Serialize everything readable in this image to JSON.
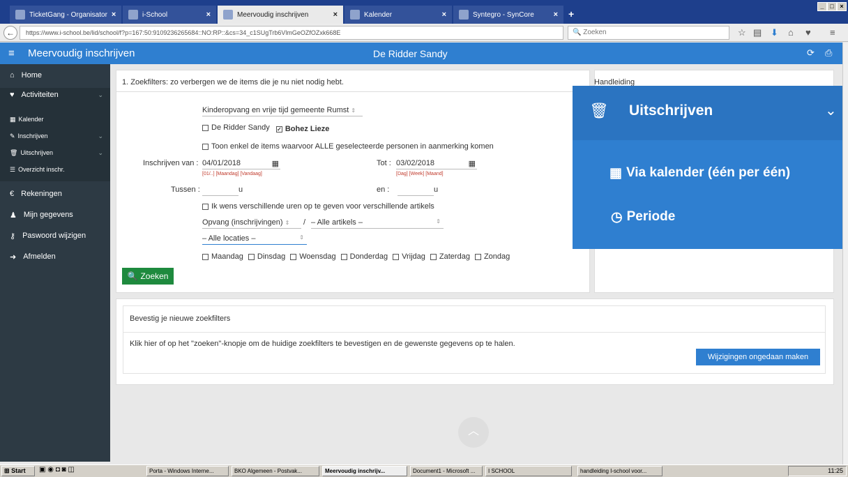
{
  "browser": {
    "tabs": [
      {
        "label": "TicketGang - Organisator"
      },
      {
        "label": "i-School"
      },
      {
        "label": "Meervoudig inschrijven"
      },
      {
        "label": "Kalender"
      },
      {
        "label": "Syntegro - SynCore"
      }
    ],
    "url": "https://www.i-school.be/lid/school/f?p=167:50:9109236265684::NO:RP::&cs=34_c1SUgTrb6VlmGeOZfOZxk668E",
    "search_placeholder": "Zoeken"
  },
  "app": {
    "title": "Meervoudig inschrijven",
    "user": "De Ridder Sandy"
  },
  "sidebar": {
    "home": "Home",
    "activiteiten": "Activiteiten",
    "kalender": "Kalender",
    "inschrijven": "Inschrijven",
    "uitschrijven": "Uitschrijven",
    "overzicht": "Overzicht inschr.",
    "rekeningen": "Rekeningen",
    "mijn_gegevens": "Mijn gegevens",
    "paswoord": "Paswoord wijzigen",
    "afmelden": "Afmelden"
  },
  "filters": {
    "heading": "1. Zoekfilters: zo verbergen we de items die je nu niet nodig hebt.",
    "group_select": "Kinderopvang en vrije tijd gemeente Rumst",
    "person1": "De Ridder Sandy",
    "person2": "Bohez Lieze",
    "only_all_label": "Toon enkel de items waarvoor ALLE geselecteerde personen in aanmerking komen",
    "inschrijven_van_label": "Inschrijven van :",
    "date_from": "04/01/2018",
    "from_shortcuts": "[01/..] [Maandag] [Vandaag]",
    "tot_label": "Tot :",
    "date_to": "03/02/2018",
    "to_shortcuts": "[Dag] [Week] [Maand]",
    "tussen_label": "Tussen :",
    "en_label": "en :",
    "hour_unit": "u",
    "different_hours_label": "Ik wens verschillende uren op te geven voor verschillende artikels",
    "type_select": "Opvang (inschrijvingen)",
    "slash": "/",
    "articles_select": "– Alle artikels –",
    "locations_select": "– Alle locaties –",
    "days": [
      "Maandag",
      "Dinsdag",
      "Woensdag",
      "Donderdag",
      "Vrijdag",
      "Zaterdag",
      "Zondag"
    ],
    "search_button": "Zoeken"
  },
  "handleiding": {
    "title": "Handleiding"
  },
  "confirm": {
    "title": "Bevestig je nieuwe zoekfilters",
    "text": "Klik hier of op het \"zoeken\"-knopje om de huidige zoekfilters te bevestigen en de gewenste gegevens op te halen.",
    "undo_button": "Wijzigingen ongedaan maken"
  },
  "overlay": {
    "title": "Uitschrijven",
    "item1": "Via kalender (één per één)",
    "item2": "Periode"
  },
  "taskbar": {
    "start": "Start",
    "items": [
      "Porta - Windows Interne...",
      "BKO Algemeen - Postvak...",
      "Meervoudig inschrijv...",
      "Document1 - Microsoft ...",
      "I SCHOOL",
      "handleiding I-school voor..."
    ],
    "clock": "11:25"
  },
  "colors": {
    "accent": "#2f7fd0",
    "sidebar": "#2d3a44",
    "green": "#1e8a3e"
  }
}
